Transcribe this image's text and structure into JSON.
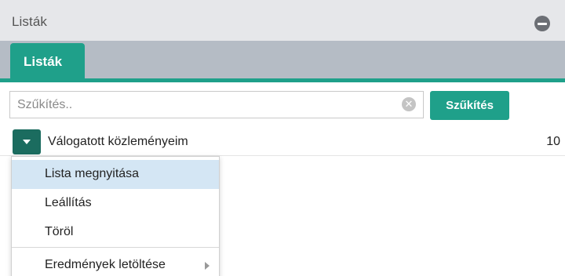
{
  "panel": {
    "title": "Listák"
  },
  "tabs": [
    {
      "label": "Listák",
      "active": true
    }
  ],
  "filter": {
    "placeholder": "Szűkítés..",
    "value": "",
    "button_label": "Szűkítés"
  },
  "lists": [
    {
      "name": "Válogatott közleményeim",
      "count": "10"
    }
  ],
  "dropdown_menu": {
    "items": [
      {
        "label": "Lista megnyitása",
        "highlighted": true
      },
      {
        "label": "Leállítás"
      },
      {
        "label": "Töröl"
      },
      {
        "label": "Eredmények letöltése",
        "has_submenu": true
      }
    ]
  },
  "icons": {
    "collapse": "minus-circle-icon",
    "clear": "clear-x-icon",
    "dropdown": "caret-down-icon",
    "submenu": "chevron-right-icon"
  },
  "colors": {
    "accent": "#1fa08a",
    "accent_dark": "#1b6c5f",
    "header_bg": "#e6e7ea",
    "tabbar_bg": "#b5bcc5",
    "menu_highlight": "#d4e6f4"
  }
}
